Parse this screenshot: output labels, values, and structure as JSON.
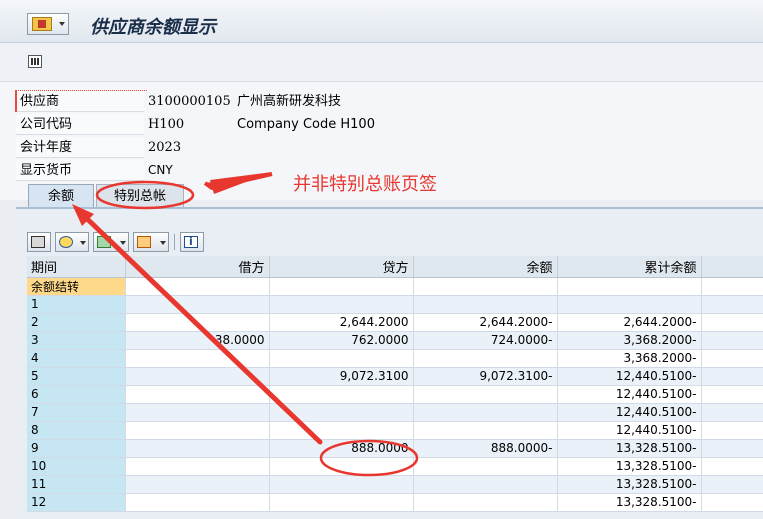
{
  "window": {
    "title": "供应商余额显示"
  },
  "header_fields": [
    {
      "label": "供应商",
      "value": "3100000105",
      "description": "广州高新研发科技"
    },
    {
      "label": "公司代码",
      "value": "H100",
      "description": "Company Code H100"
    },
    {
      "label": "会计年度",
      "value": "2023",
      "description": ""
    },
    {
      "label": "显示货币",
      "value": "CNY",
      "description": ""
    }
  ],
  "tabs": [
    {
      "label": "余额",
      "active": true
    },
    {
      "label": "特别总帐",
      "active": false
    }
  ],
  "annotation": {
    "text": "并非特别总账页签",
    "color": "#e8372f"
  },
  "table": {
    "columns": [
      "期间",
      "借方",
      "贷方",
      "余额",
      "累计余额"
    ],
    "rows": [
      [
        "余额结转",
        "",
        "",
        "",
        ""
      ],
      [
        "1",
        "",
        "",
        "",
        ""
      ],
      [
        "2",
        "",
        "2,644.2000",
        "2,644.2000-",
        "2,644.2000-"
      ],
      [
        "3",
        "38.0000",
        "762.0000",
        "724.0000-",
        "3,368.2000-"
      ],
      [
        "4",
        "",
        "",
        "",
        "3,368.2000-"
      ],
      [
        "5",
        "",
        "9,072.3100",
        "9,072.3100-",
        "12,440.5100-"
      ],
      [
        "6",
        "",
        "",
        "",
        "12,440.5100-"
      ],
      [
        "7",
        "",
        "",
        "",
        "12,440.5100-"
      ],
      [
        "8",
        "",
        "",
        "",
        "12,440.5100-"
      ],
      [
        "9",
        "",
        "888.0000",
        "888.0000-",
        "13,328.5100-"
      ],
      [
        "10",
        "",
        "",
        "",
        "13,328.5100-"
      ],
      [
        "11",
        "",
        "",
        "",
        "13,328.5100-"
      ],
      [
        "12",
        "",
        "",
        "",
        "13,328.5100-"
      ]
    ]
  },
  "icons": {
    "menu": "command-icon",
    "app_toolbar": "columns-icon",
    "grid_toolbar": [
      "print-icon",
      "details-icon",
      "export-icon",
      "layout-icon",
      "info-icon"
    ]
  }
}
